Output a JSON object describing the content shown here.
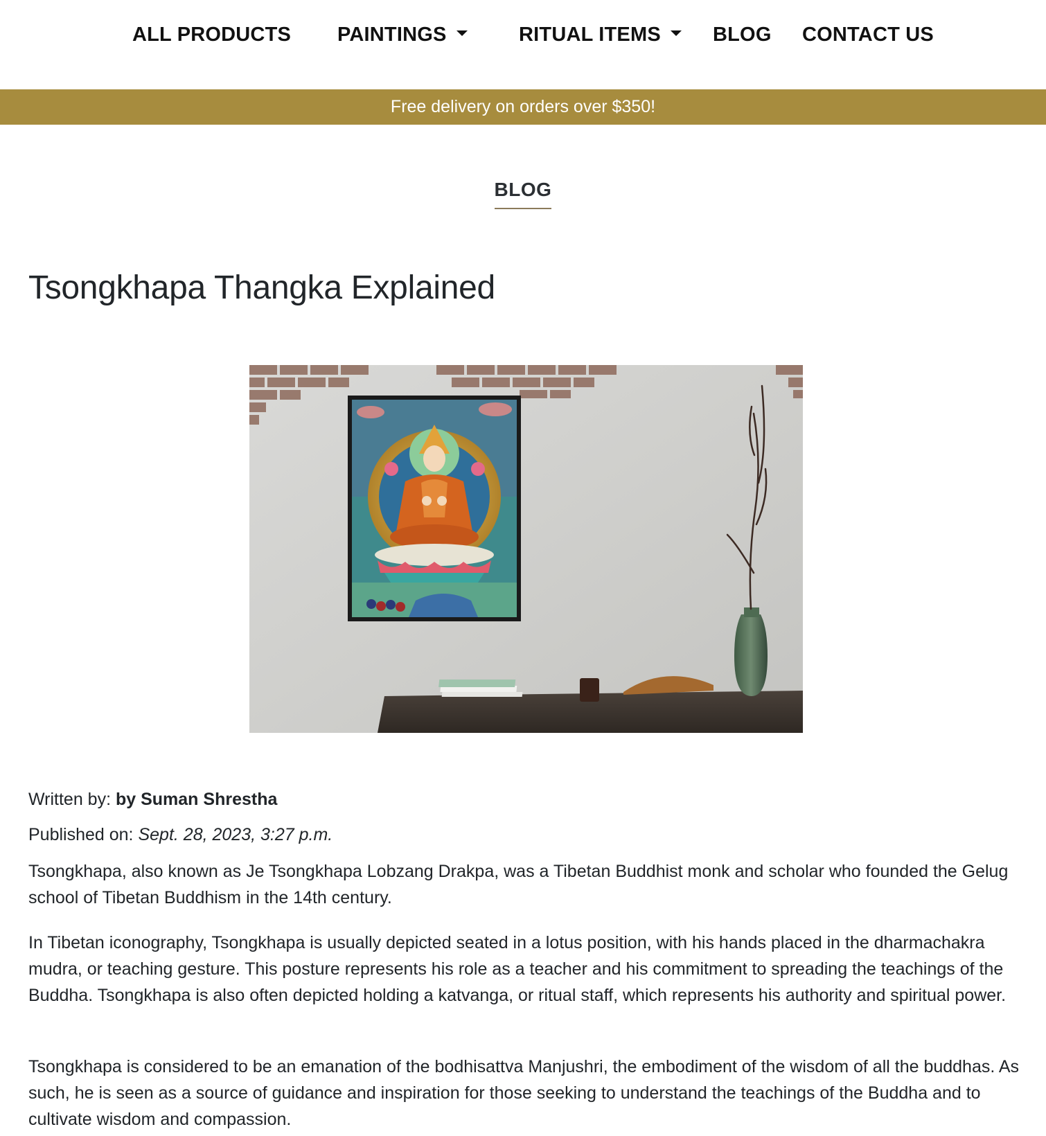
{
  "nav": {
    "items": [
      {
        "label": "ALL PRODUCTS",
        "dropdown": false
      },
      {
        "label": "PAINTINGS",
        "dropdown": true
      },
      {
        "label": "RITUAL ITEMS",
        "dropdown": true
      },
      {
        "label": "BLOG",
        "dropdown": false
      },
      {
        "label": "CONTACT US",
        "dropdown": false
      }
    ]
  },
  "banner": {
    "text": "Free delivery on orders over $350!",
    "color": "#a78c3e"
  },
  "section": {
    "heading": "BLOG"
  },
  "post": {
    "title": "Tsongkhapa Thangka Explained",
    "image_description_icon": "thangka-photo",
    "author_label": "Written by:",
    "author": "by Suman Shrestha",
    "published_label": "Published on:",
    "published": "Sept. 28, 2023, 3:27 p.m.",
    "paragraphs": [
      "Tsongkhapa, also known as Je Tsongkhapa Lobzang Drakpa, was a Tibetan Buddhist monk and scholar who founded the Gelug school of Tibetan Buddhism in the 14th century.",
      "In Tibetan iconography, Tsongkhapa is usually depicted seated in a lotus position, with his hands placed in the dharmachakra mudra, or teaching gesture. This posture represents his role as a teacher and his commitment to spreading the teachings of the Buddha. Tsongkhapa is also often depicted holding a katvanga, or ritual staff, which represents his authority and spiritual power.",
      "Tsongkhapa is considered to be an emanation of the bodhisattva Manjushri, the embodiment of the wisdom of all the buddhas. As such, he is seen as a source of guidance and inspiration for those seeking to understand the teachings of the Buddha and to cultivate wisdom and compassion."
    ]
  }
}
